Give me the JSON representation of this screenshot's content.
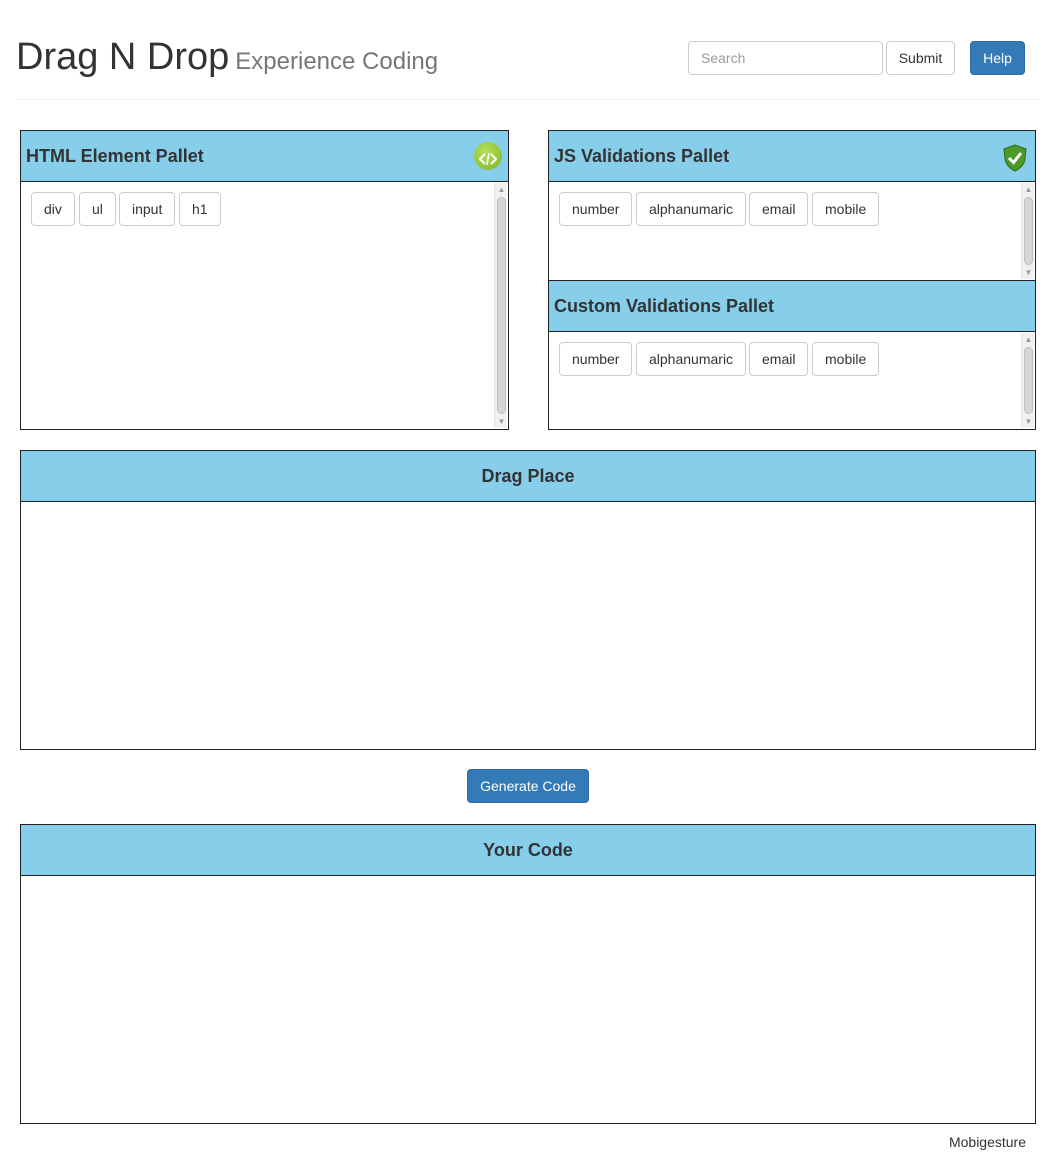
{
  "header": {
    "title": "Drag N Drop",
    "subtitle": "Experience Coding",
    "search_placeholder": "Search",
    "submit_label": "Submit",
    "help_label": "Help"
  },
  "html_pallet": {
    "title": "HTML Element Pallet",
    "icon": "code-icon",
    "items": [
      "div",
      "ul",
      "input",
      "h1"
    ]
  },
  "js_pallet": {
    "title": "JS Validations Pallet",
    "icon": "shield-check-icon",
    "items": [
      "number",
      "alphanumaric",
      "email",
      "mobile"
    ]
  },
  "custom_pallet": {
    "title": "Custom Validations Pallet",
    "items": [
      "number",
      "alphanumaric",
      "email",
      "mobile"
    ]
  },
  "drag_place": {
    "title": "Drag Place"
  },
  "generate_label": "Generate Code",
  "your_code": {
    "title": "Your Code"
  },
  "footer": "Mobigesture",
  "colors": {
    "panel_header": "#87ceeb",
    "primary": "#337ab7"
  }
}
